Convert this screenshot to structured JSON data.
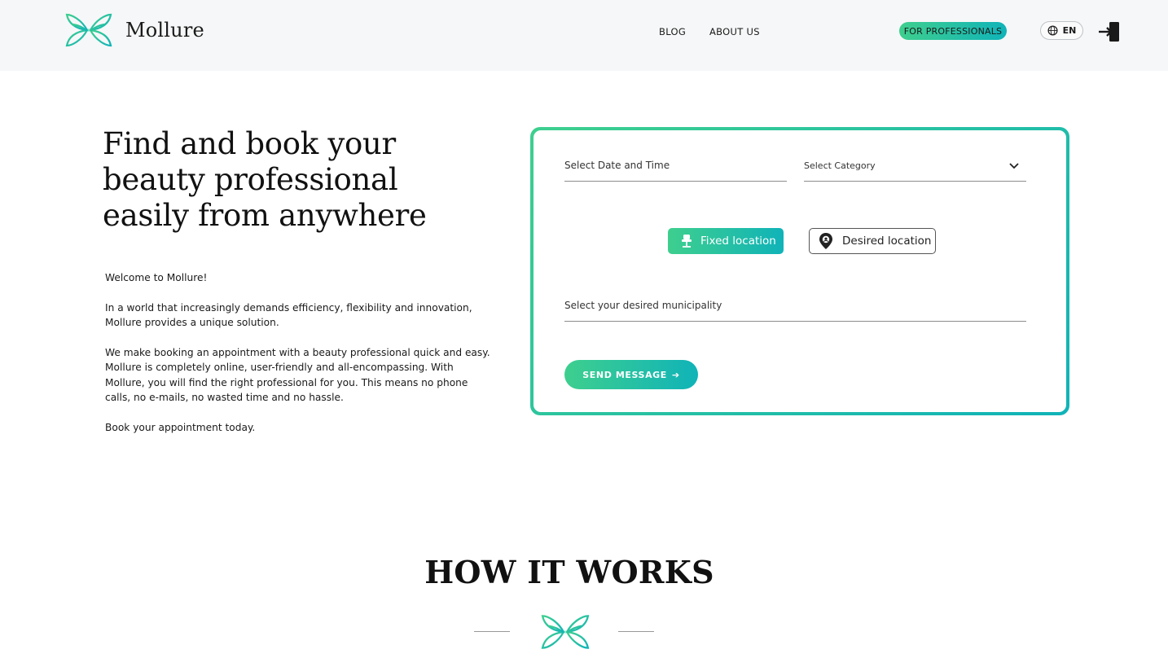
{
  "header": {
    "brand": "Mollure",
    "nav": {
      "blog": "BLOG",
      "about": "ABOUT US"
    },
    "professionals_button": "FOR PROFESSIONALS",
    "language": "EN",
    "icons": {
      "logo": "butterfly-logo-icon",
      "language": "globe-icon",
      "login": "login-door-icon"
    }
  },
  "hero": {
    "title": "Find and book your beauty professional easily from anywhere",
    "paragraphs": [
      "Welcome to Mollure!",
      "In a world that increasingly demands efficiency, flexibility and innovation, Mollure provides a unique solution.",
      "We make booking an appointment with a beauty professional quick and easy. Mollure is completely online, user-friendly and all-encompassing. With Mollure, you will find the right professional for you. This means no phone calls, no e-mails, no wasted time and no hassle.",
      "Book your appointment today."
    ]
  },
  "form": {
    "date_placeholder": "Select Date and Time",
    "category_placeholder": "Select Category",
    "location_fixed": "Fixed location",
    "location_desired": "Desired location",
    "municipality_placeholder": "Select  your desired municipality",
    "send_button": "SEND MESSAGE",
    "send_arrow": "➔"
  },
  "how_it_works": {
    "title": "HOW IT WORKS"
  },
  "colors": {
    "accent_start": "#3ecf8e",
    "accent_end": "#10b3b8",
    "header_bg": "#f6f7f8"
  }
}
